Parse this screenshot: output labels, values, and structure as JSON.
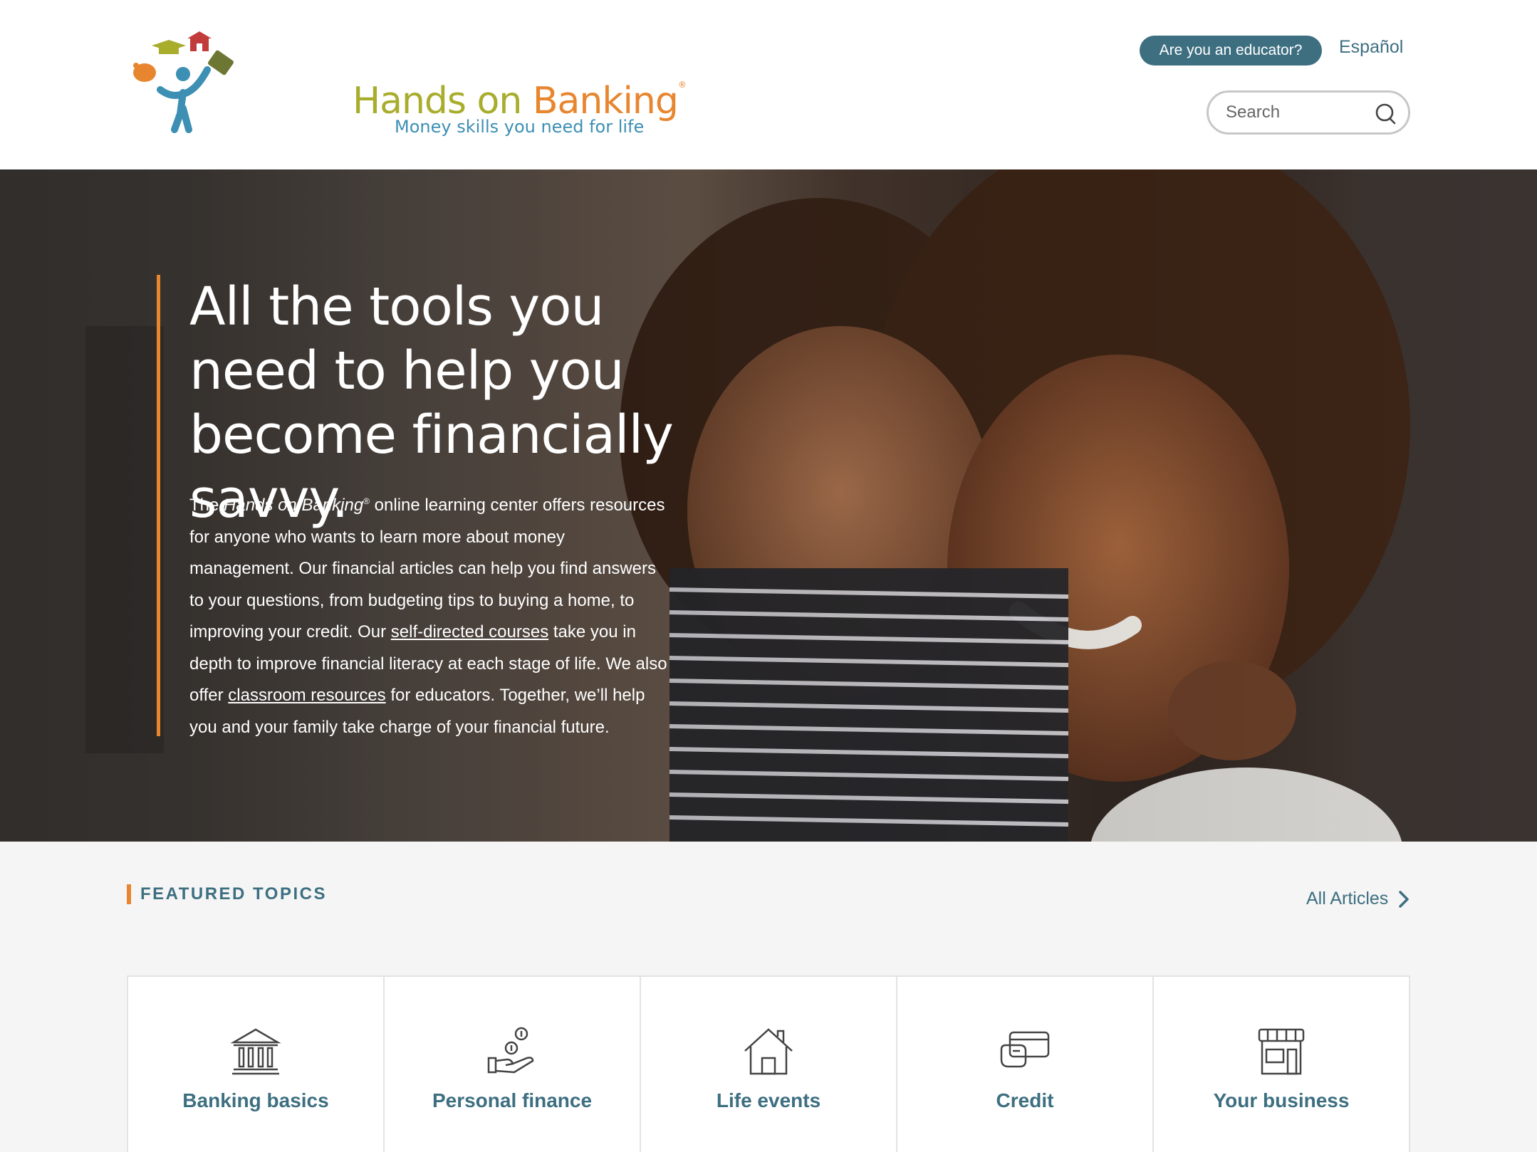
{
  "logo": {
    "title_part1": "Hands on ",
    "title_part2": "Banking",
    "registered": "®",
    "tagline": "Money skills you need for life"
  },
  "header": {
    "educator_button": "Are you an educator?",
    "language_link": "Español",
    "search_placeholder": "Search"
  },
  "hero": {
    "title": "All the tools you need to help you become financially savvy.",
    "body": {
      "p1": "The ",
      "brand": "Hands on Banking",
      "reg": "®",
      "p2": " online learning center offers resources for anyone who wants to learn more about money management. Our financial articles can help you find answers to your questions, from budgeting tips to buying a home, to improving your credit. Our ",
      "link1": "self-directed courses",
      "p3": " take you in depth to improve financial literacy at each stage of life. We also offer ",
      "link2": "classroom resources",
      "p4": " for educators. Together, we’ll help you and your family take charge of your financial future."
    }
  },
  "featured": {
    "title": "FEATURED TOPICS",
    "all_articles": "All Articles",
    "topics": [
      {
        "label": "Banking basics",
        "icon": "bank-icon"
      },
      {
        "label": "Personal finance",
        "icon": "hand-coins-icon"
      },
      {
        "label": "Life events",
        "icon": "house-icon"
      },
      {
        "label": "Credit",
        "icon": "credit-card-icon"
      },
      {
        "label": "Your business",
        "icon": "storefront-icon"
      }
    ]
  },
  "colors": {
    "brand_teal": "#3d6f81",
    "accent_orange": "#e8862f",
    "logo_green": "#a8ad2c",
    "logo_blue": "#3d8fb3"
  }
}
